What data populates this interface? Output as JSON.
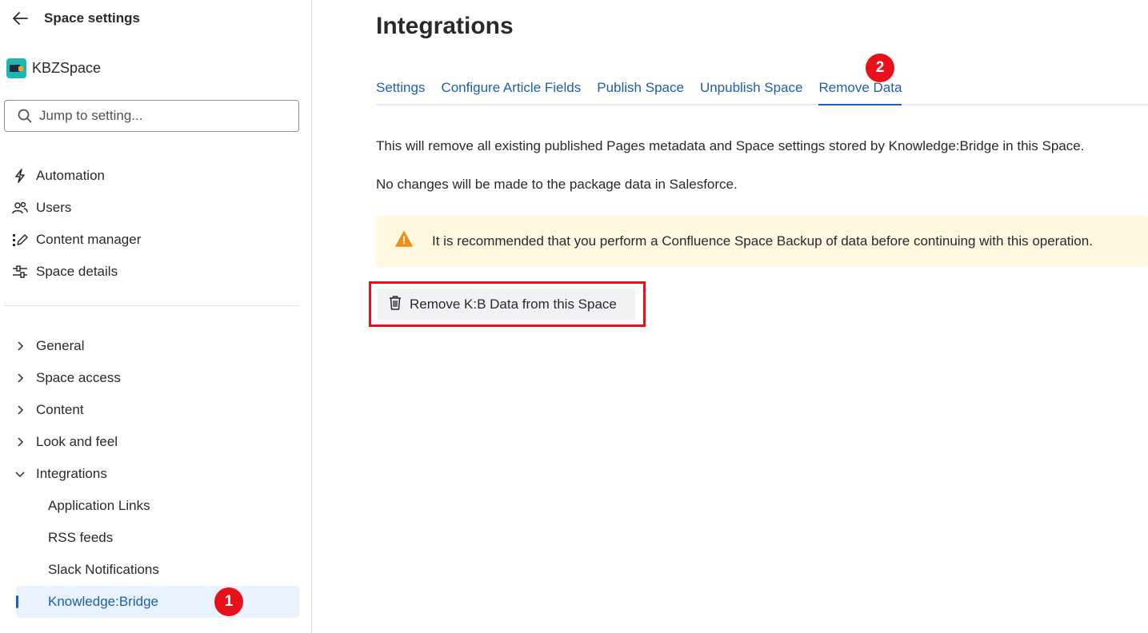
{
  "sidebar": {
    "title": "Space settings",
    "space_name": "KBZSpace",
    "search_placeholder": "Jump to setting...",
    "nav": [
      {
        "label": "Automation",
        "icon": "lightning-icon"
      },
      {
        "label": "Users",
        "icon": "users-icon"
      },
      {
        "label": "Content manager",
        "icon": "content-manager-icon"
      },
      {
        "label": "Space details",
        "icon": "space-details-icon"
      }
    ],
    "tree": [
      {
        "label": "General",
        "expanded": false
      },
      {
        "label": "Space access",
        "expanded": false
      },
      {
        "label": "Content",
        "expanded": false
      },
      {
        "label": "Look and feel",
        "expanded": false
      },
      {
        "label": "Integrations",
        "expanded": true
      }
    ],
    "integrations_children": [
      {
        "label": "Application Links"
      },
      {
        "label": "RSS feeds"
      },
      {
        "label": "Slack Notifications"
      },
      {
        "label": "Knowledge:Bridge",
        "active": true
      }
    ]
  },
  "annotations": {
    "badge_1": "1",
    "badge_2": "2"
  },
  "main": {
    "title": "Integrations",
    "tabs": [
      {
        "label": "Settings"
      },
      {
        "label": "Configure Article Fields"
      },
      {
        "label": "Publish Space"
      },
      {
        "label": "Unpublish Space"
      },
      {
        "label": "Remove Data",
        "active": true
      }
    ],
    "paragraph_1": "This will remove all existing published Pages metadata and Space settings stored by Knowledge:Bridge in this Space.",
    "paragraph_2": "No changes will be made to the package data in Salesforce.",
    "warning_text": "It is recommended that you perform a Confluence Space Backup of data before continuing with this operation.",
    "remove_button_label": "Remove K:B Data from this Space"
  },
  "colors": {
    "link_blue": "#1d5fb2",
    "badge_red": "#e8101b",
    "warning_bg": "#fff7e0",
    "warning_icon": "#f18d13"
  }
}
